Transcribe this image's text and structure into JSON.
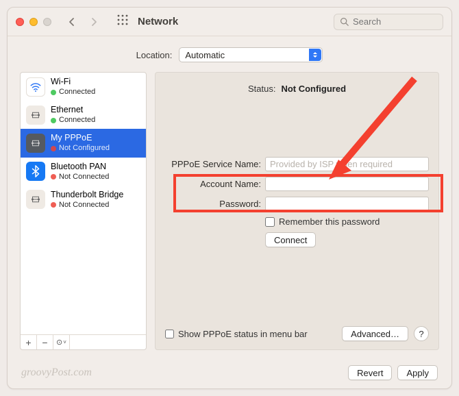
{
  "window": {
    "title": "Network"
  },
  "search": {
    "placeholder": "Search"
  },
  "location": {
    "label": "Location:",
    "value": "Automatic"
  },
  "sidebar": {
    "items": [
      {
        "name": "Wi-Fi",
        "status": "Connected",
        "dot": "green",
        "icon": "wifi"
      },
      {
        "name": "Ethernet",
        "status": "Connected",
        "dot": "green",
        "icon": "ethernet"
      },
      {
        "name": "My PPPoE",
        "status": "Not Configured",
        "dot": "red",
        "icon": "ethernet",
        "selected": true
      },
      {
        "name": "Bluetooth PAN",
        "status": "Not Connected",
        "dot": "red",
        "icon": "bluetooth"
      },
      {
        "name": "Thunderbolt Bridge",
        "status": "Not Connected",
        "dot": "red",
        "icon": "ethernet"
      }
    ]
  },
  "main": {
    "status_label": "Status:",
    "status_value": "Not Configured",
    "fields": {
      "service_name_label": "PPPoE Service Name:",
      "service_name_placeholder": "Provided by ISP when required",
      "account_label": "Account Name:",
      "password_label": "Password:",
      "remember_label": "Remember this password",
      "connect_label": "Connect"
    },
    "show_status_label": "Show PPPoE status in menu bar",
    "advanced_label": "Advanced…",
    "help_label": "?"
  },
  "footer": {
    "revert": "Revert",
    "apply": "Apply",
    "watermark": "groovyPost.com"
  }
}
